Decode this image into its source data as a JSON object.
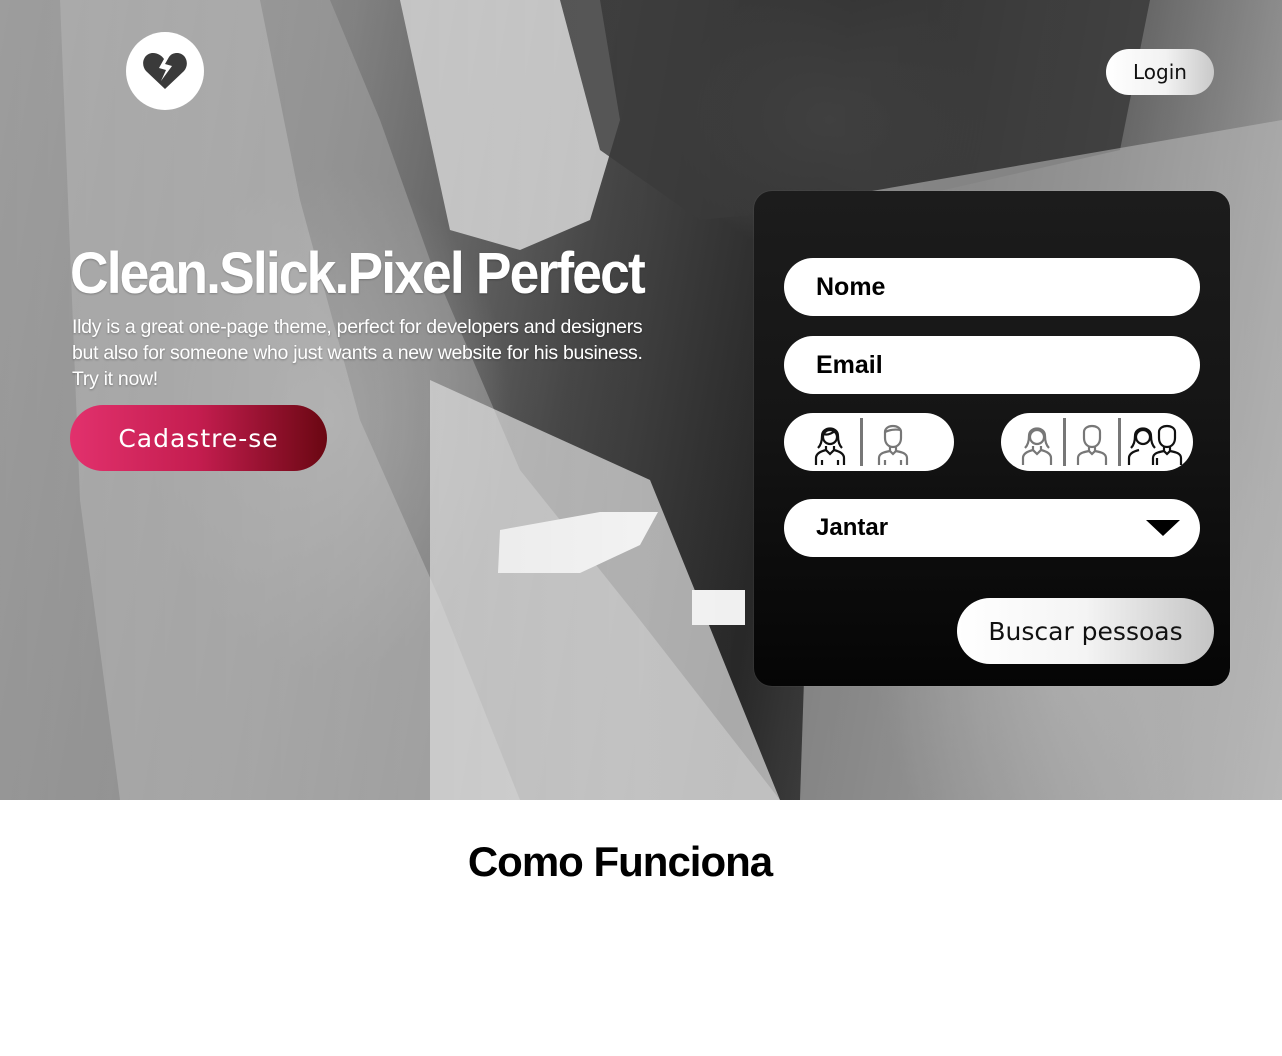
{
  "header": {
    "logo_icon": "broken-heart-icon",
    "login_label": "Login"
  },
  "hero": {
    "headline": "Clean.Slick.Pixel Perfect",
    "subtitle": "Ildy is a great one-page theme, perfect for developers and designers but also for someone who just wants a new website for his business. Try it now!",
    "signup_label": "Cadastre-se"
  },
  "search_form": {
    "name_placeholder": "Nome",
    "email_placeholder": "Email",
    "gender_options": [
      "female-icon",
      "male-icon"
    ],
    "seeking_options": [
      "female-icon",
      "male-icon",
      "couple-icon"
    ],
    "activity_selected": "Jantar",
    "search_label": "Buscar pessoas"
  },
  "section": {
    "title": "Como Funciona"
  },
  "colors": {
    "accent_start": "#e2316d",
    "accent_end": "#6a0712",
    "panel": "#151515"
  }
}
